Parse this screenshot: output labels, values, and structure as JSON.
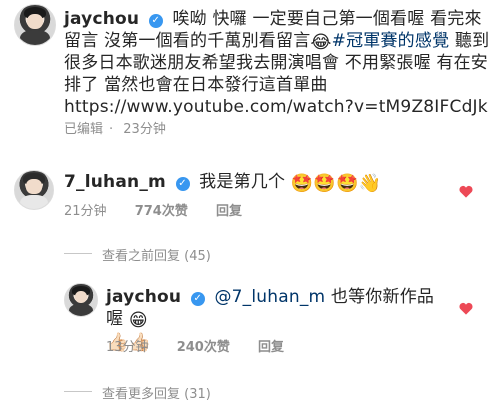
{
  "post": {
    "username": "jaychou",
    "caption_part1": "唉呦 快囉 一定要自己第一個看喔 看完來留言 沒第一個看的千萬別看留言",
    "caption_emoji": "😂",
    "hashtag": "#冠軍賽的感覺",
    "caption_part2": "聽到很多日本歌迷朋友希望我去開演唱會 不用緊張喔 有在安排了 當然也會在日本發行這首單曲",
    "link": "https://www.youtube.com/watch?v=tM9Z8IFCdJk",
    "edited": "已编辑",
    "time": "23分钟"
  },
  "comment1": {
    "username": "7_luhan_m",
    "text": "我是第几个",
    "emojis": "🤩🤩🤩👋",
    "time": "21分钟",
    "likes": "774次赞",
    "reply": "回复"
  },
  "view_previous": "查看之前回复 (45)",
  "reply1": {
    "username": "jaychou",
    "mention": "@7_luhan_m",
    "text": "也等你新作品喔",
    "emoji": "😁",
    "emojis_line2": "👍🏻👍🏻",
    "time": "13分钟",
    "likes": "240次赞",
    "reply": "回复"
  },
  "view_more": "查看更多回复 (31)",
  "colors": {
    "heart": "#ed4956",
    "link": "#003569",
    "verified": "#3897f0",
    "meta": "#8e8e8e"
  },
  "icons": [
    "verified-badge-icon",
    "heart-icon"
  ]
}
